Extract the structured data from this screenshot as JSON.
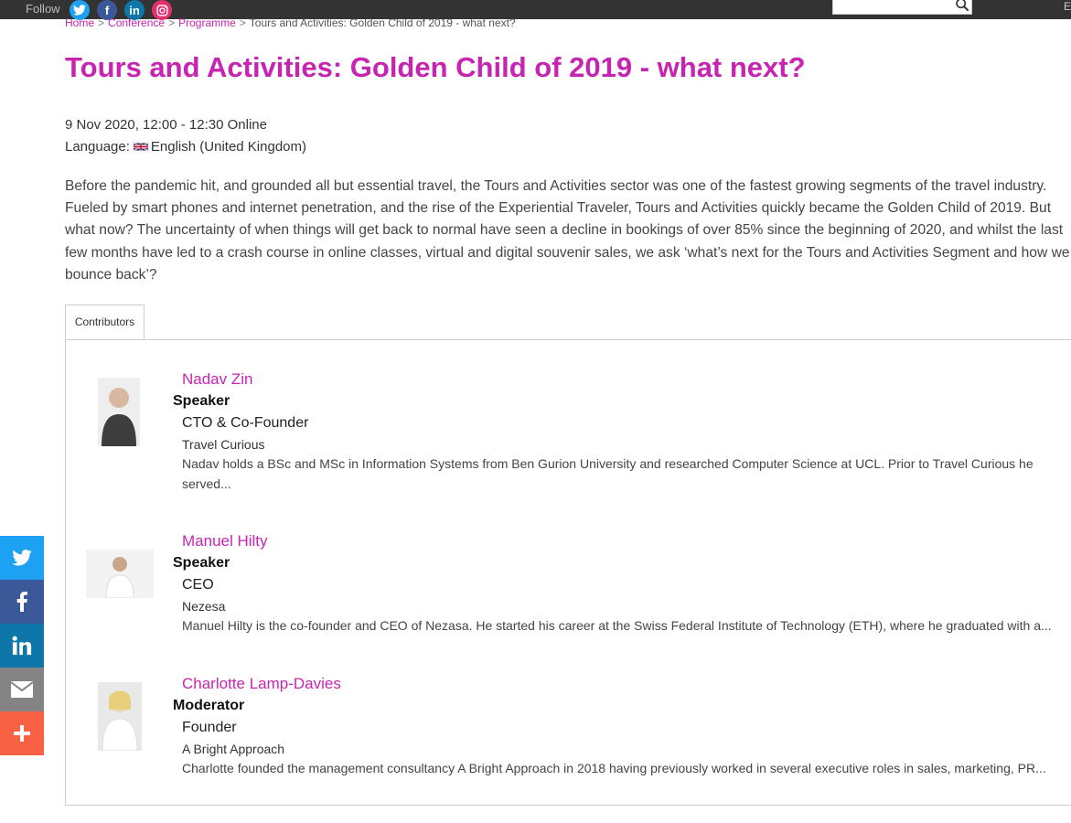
{
  "topbar": {
    "follow_label": "Follow",
    "social": [
      "twitter-icon",
      "facebook-icon",
      "linkedin-icon",
      "instagram-icon"
    ],
    "edge_text": "E"
  },
  "breadcrumb": {
    "items": [
      "Home",
      "Conference",
      "Programme"
    ],
    "current": "Tours and Activities: Golden Child of 2019 - what next?",
    "separator": ">"
  },
  "page": {
    "title": "Tours and Activities: Golden Child of 2019 - what next?",
    "datetime": "9 Nov 2020, 12:00 - 12:30 Online",
    "language_label": "Language:",
    "language_value": "English (United Kingdom)",
    "description": "Before the pandemic hit, and grounded all but essential travel, the Tours and Activities sector was one of the fastest growing segments of the travel industry. Fueled by smart phones and internet penetration, and the rise of the Experiential Traveler, Tours and Activities quickly became the Golden Child of 2019. But what now? The uncertainty of when things will get back to normal have seen a decline in bookings of over 85% since the beginning of 2020, and whilst the last few months have led to a crash course in online classes, virtual and digital souvenir sales, we ask ‘what’s next for the Tours and Activities Segment and how we bounce back’?"
  },
  "tabs": {
    "contributors_label": "Contributors"
  },
  "contributors": [
    {
      "name": "Nadav Zin",
      "role": "Speaker",
      "job": "CTO & Co-Founder",
      "org": "Travel Curious",
      "bio": "Nadav holds a BSc and MSc in Information Systems from Ben Gurion University and researched Computer Science at UCL. Prior to Travel Curious he served..."
    },
    {
      "name": "Manuel Hilty",
      "role": "Speaker",
      "job": "CEO",
      "org": "Nezesa",
      "bio": "Manuel Hilty is the co-founder and CEO of Nezasa. He started his career at the Swiss Federal Institute of Technology (ETH), where he graduated with a..."
    },
    {
      "name": "Charlotte Lamp-Davies",
      "role": "Moderator",
      "job": "Founder",
      "org": "A Bright Approach",
      "bio": "Charlotte founded the management consultancy A Bright Approach in 2018 having previously worked in several executive roles in sales, marketing, PR..."
    }
  ],
  "side_share": [
    "twitter-icon",
    "facebook-icon",
    "linkedin-icon",
    "email-icon",
    "plus-icon"
  ],
  "colors": {
    "accent": "#c724b1",
    "topbar": "#333333",
    "twitter": "#1da1f2",
    "facebook": "#3b5998",
    "linkedin": "#0e76a8",
    "email": "#848484",
    "more": "#f86143"
  }
}
